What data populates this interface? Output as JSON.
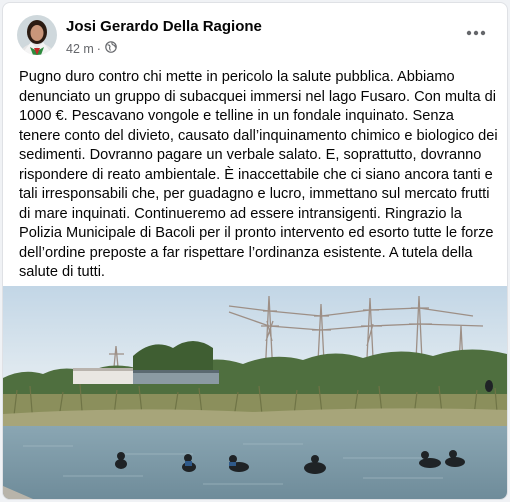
{
  "post": {
    "author": "Josi Gerardo Della Ragione",
    "time": "42 m",
    "separator": "·",
    "privacy_icon": "globe-icon",
    "more_icon": "more-options-icon",
    "text": "Pugno duro contro chi mette in pericolo la salute pubblica. Abbiamo denunciato un gruppo di subacquei immersi nel lago Fusaro. Con multa di 1000 €. Pescavano vongole e telline in un fondale inquinato. Senza tenere conto del divieto, causato dall’inquinamento chimico e biologico dei sedimenti. Dovranno pagare un verbale salato. E, soprattutto, dovranno rispondere di reato ambientale. È inaccettabile che ci siano ancora tanti e tali irresponsabili che, per guadagno e lucro, immettano sul mercato frutti di mare inquinati. Continueremo ad essere intransigenti. Ringrazio la Polizia Municipale di Bacoli per il pronto intervento ed esorto tutte le forze dell’ordine preposte a far rispettare l’ordinanza esistente. A tutela della salute di tutti."
  },
  "colors": {
    "background": "#f0f2f5",
    "card": "#ffffff",
    "primary_text": "#050505",
    "secondary_text": "#65676b"
  }
}
